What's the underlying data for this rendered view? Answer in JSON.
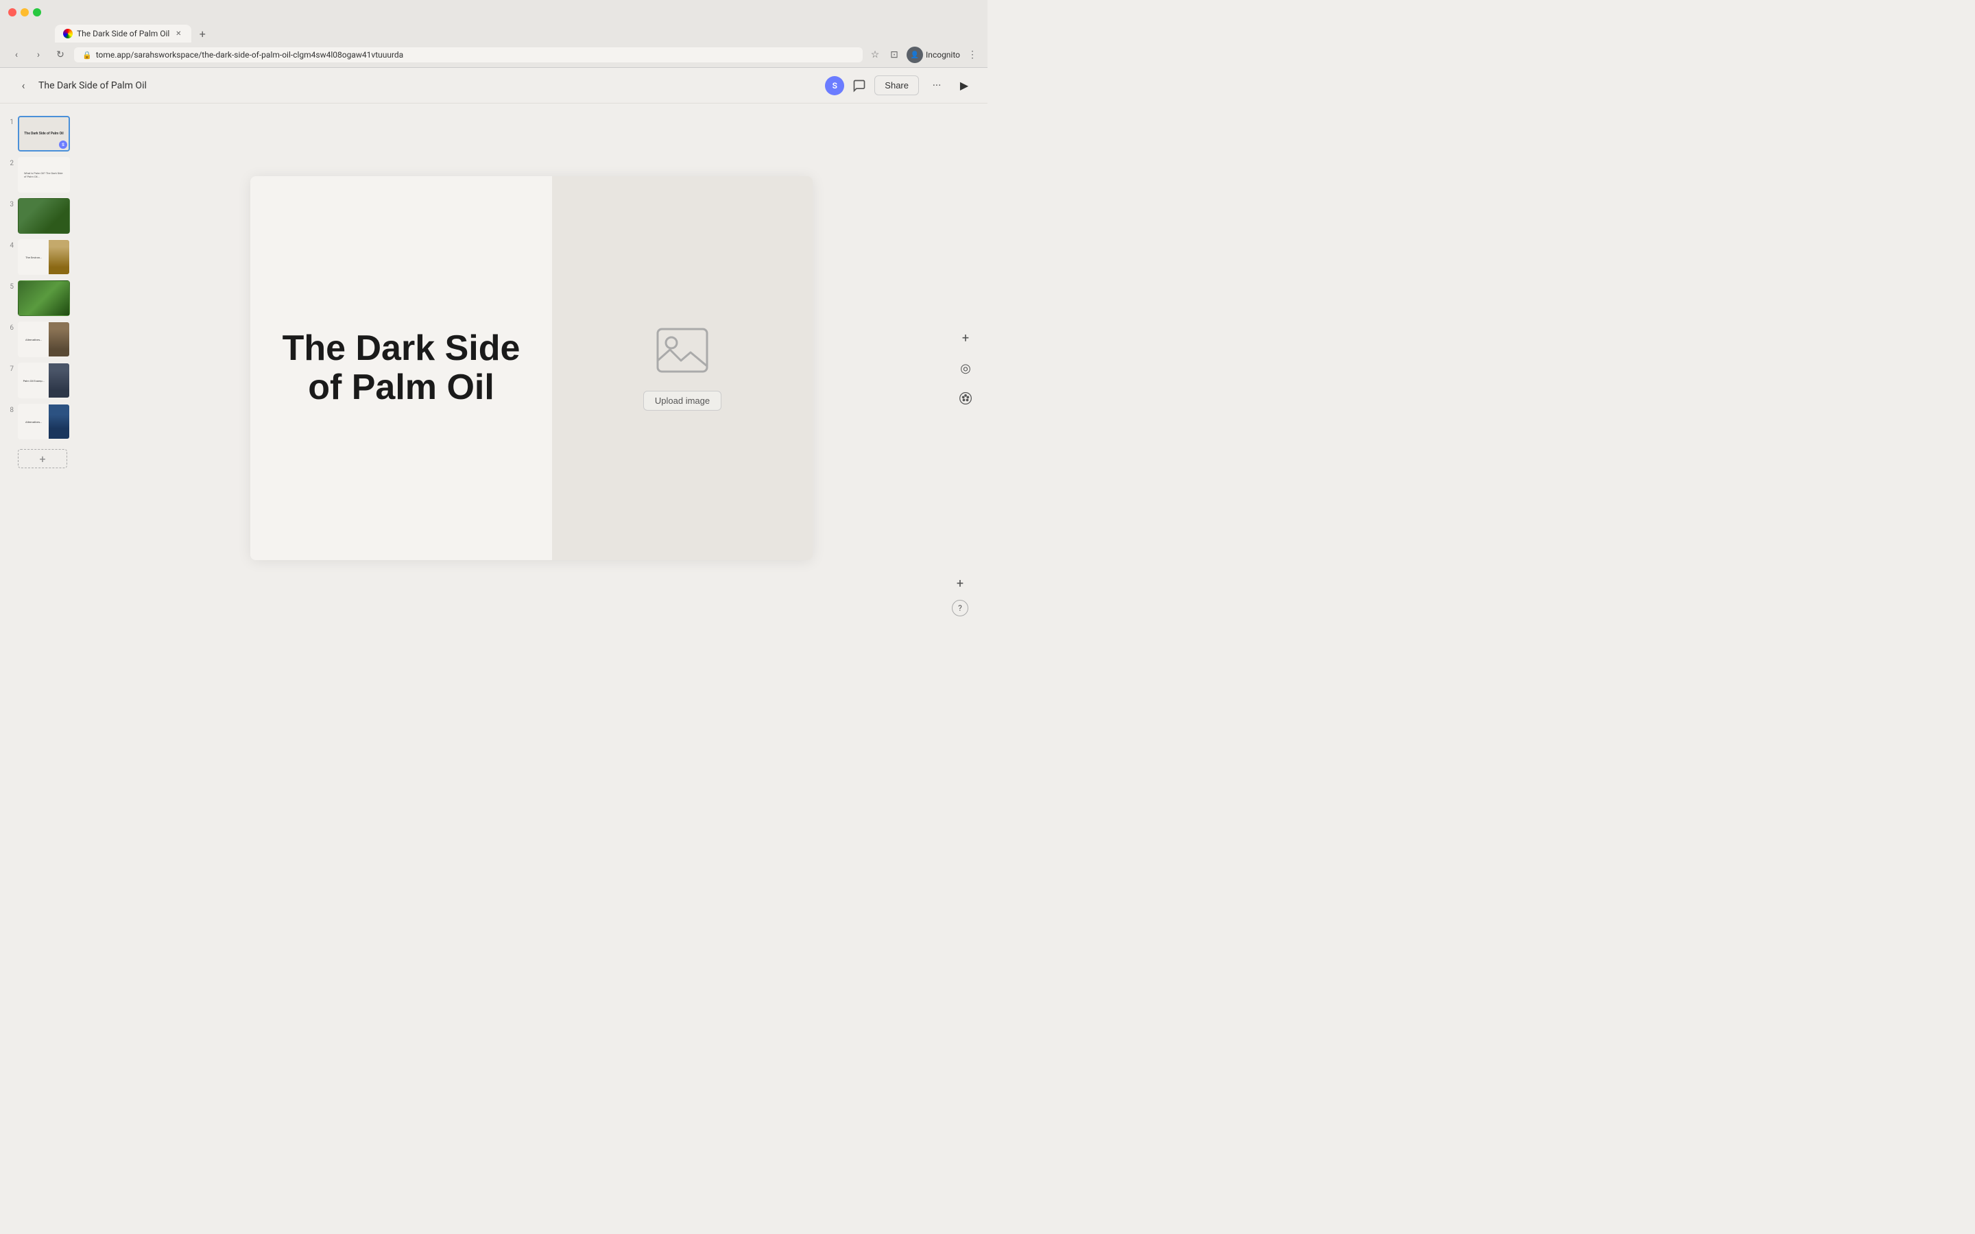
{
  "browser": {
    "tab_title": "The Dark Side of Palm Oil",
    "url": "tome.app/sarahsworkspace/the-dark-side-of-palm-oil-clgm4sw4l08ogaw41vtuuurda",
    "incognito_label": "Incognito"
  },
  "header": {
    "back_label": "‹",
    "doc_title": "The Dark Side of Palm Oil",
    "user_initial": "S",
    "share_label": "Share",
    "more_label": "···",
    "play_label": "▶"
  },
  "sidebar": {
    "slides": [
      {
        "number": "1",
        "active": true,
        "type": "title"
      },
      {
        "number": "2",
        "active": false,
        "type": "text"
      },
      {
        "number": "3",
        "active": false,
        "type": "forest"
      },
      {
        "number": "4",
        "active": false,
        "type": "desert"
      },
      {
        "number": "5",
        "active": false,
        "type": "palm"
      },
      {
        "number": "6",
        "active": false,
        "type": "bottles"
      },
      {
        "number": "7",
        "active": false,
        "type": "dark"
      },
      {
        "number": "8",
        "active": false,
        "type": "city"
      }
    ],
    "add_slide_label": "+"
  },
  "slide": {
    "title": "The Dark Side of Palm Oil",
    "upload_btn_label": "Upload image"
  },
  "tools": {
    "add_icon": "+",
    "target_icon": "◎",
    "palette_icon": "🎨"
  },
  "bottom": {
    "plus_icon": "+",
    "help_icon": "?"
  }
}
